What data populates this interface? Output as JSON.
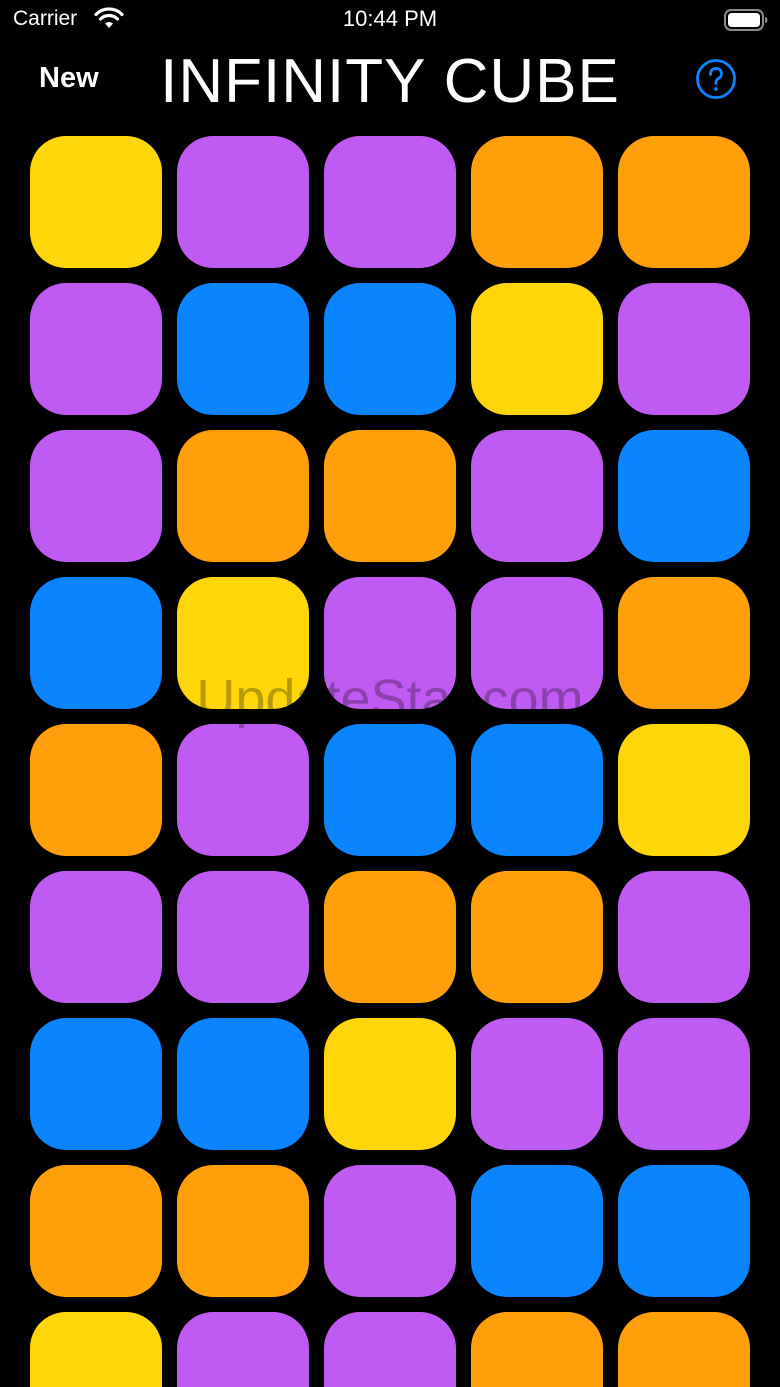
{
  "status_bar": {
    "carrier": "Carrier",
    "time": "10:44 PM"
  },
  "nav": {
    "new_label": "New",
    "title": "INFINITY CUBE",
    "help_icon": "question-circle-icon"
  },
  "watermark": "UpdateStar.com",
  "colors": {
    "yellow": "#FFD60A",
    "purple": "#BF5AF2",
    "orange": "#FF9F0A",
    "blue": "#0A84FF",
    "accent": "#0A84FF",
    "background": "#000000"
  },
  "board": [
    [
      "yellow",
      "purple",
      "purple",
      "orange",
      "orange"
    ],
    [
      "purple",
      "blue",
      "blue",
      "yellow",
      "purple"
    ],
    [
      "purple",
      "orange",
      "orange",
      "purple",
      "blue"
    ],
    [
      "blue",
      "yellow",
      "purple",
      "purple",
      "orange"
    ],
    [
      "orange",
      "purple",
      "blue",
      "blue",
      "yellow"
    ],
    [
      "purple",
      "purple",
      "orange",
      "orange",
      "purple"
    ],
    [
      "blue",
      "blue",
      "yellow",
      "purple",
      "purple"
    ],
    [
      "orange",
      "orange",
      "purple",
      "blue",
      "blue"
    ],
    [
      "yellow",
      "purple",
      "purple",
      "orange",
      "orange"
    ]
  ]
}
